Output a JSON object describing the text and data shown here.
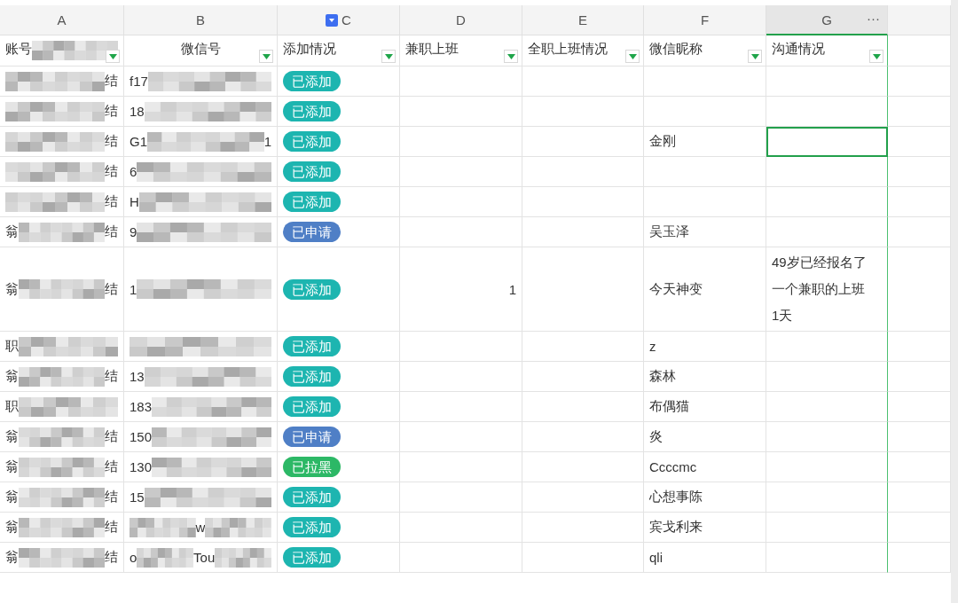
{
  "columns": [
    {
      "letter": "A",
      "selected": false,
      "filtered": false,
      "header": [
        {
          "kind": "text",
          "text": "账号"
        },
        {
          "kind": "mosaic"
        }
      ]
    },
    {
      "letter": "B",
      "selected": false,
      "filtered": false,
      "header": [
        {
          "kind": "text",
          "text": "微信号"
        }
      ]
    },
    {
      "letter": "C",
      "selected": false,
      "filtered": true,
      "header": [
        {
          "kind": "text",
          "text": "添加情况"
        }
      ]
    },
    {
      "letter": "D",
      "selected": false,
      "filtered": false,
      "header": [
        {
          "kind": "text",
          "text": "兼职上班"
        }
      ]
    },
    {
      "letter": "E",
      "selected": false,
      "filtered": false,
      "header": [
        {
          "kind": "text",
          "text": "全职上班情况"
        }
      ]
    },
    {
      "letter": "F",
      "selected": false,
      "filtered": false,
      "header": [
        {
          "kind": "text",
          "text": "微信昵称"
        }
      ]
    },
    {
      "letter": "G",
      "selected": true,
      "filtered": false,
      "more": "···",
      "header": [
        {
          "kind": "text",
          "text": "沟通情况"
        }
      ]
    }
  ],
  "rows": [
    {
      "account": [
        {
          "kind": "mosaic"
        },
        {
          "kind": "text",
          "text": "结"
        }
      ],
      "wechat_id": [
        {
          "kind": "text",
          "text": "f17"
        },
        {
          "kind": "mosaic"
        }
      ],
      "status": {
        "text": "已添加",
        "color": "#1db5b0"
      },
      "notes": {
        "selected": false
      }
    },
    {
      "account": [
        {
          "kind": "mosaic"
        },
        {
          "kind": "text",
          "text": "结"
        }
      ],
      "wechat_id": [
        {
          "kind": "text",
          "text": "18"
        },
        {
          "kind": "mosaic"
        }
      ],
      "status": {
        "text": "已添加",
        "color": "#1db5b0"
      },
      "notes": {
        "selected": false
      }
    },
    {
      "account": [
        {
          "kind": "mosaic"
        },
        {
          "kind": "text",
          "text": "结"
        }
      ],
      "wechat_id": [
        {
          "kind": "text",
          "text": "G1"
        },
        {
          "kind": "mosaic"
        },
        {
          "kind": "text",
          "text": "1"
        }
      ],
      "status": {
        "text": "已添加",
        "color": "#1db5b0"
      },
      "nickname": "金刚",
      "notes": {
        "selected": true
      }
    },
    {
      "account": [
        {
          "kind": "mosaic"
        },
        {
          "kind": "text",
          "text": "结"
        }
      ],
      "wechat_id": [
        {
          "kind": "text",
          "text": "6"
        },
        {
          "kind": "mosaic"
        }
      ],
      "status": {
        "text": "已添加",
        "color": "#1db5b0"
      },
      "notes": {
        "selected": false
      }
    },
    {
      "account": [
        {
          "kind": "mosaic"
        },
        {
          "kind": "text",
          "text": "结"
        }
      ],
      "wechat_id": [
        {
          "kind": "text",
          "text": "H"
        },
        {
          "kind": "mosaic"
        }
      ],
      "status": {
        "text": "已添加",
        "color": "#1db5b0"
      },
      "notes": {
        "selected": false
      }
    },
    {
      "account": [
        {
          "kind": "text",
          "text": "翁"
        },
        {
          "kind": "mosaic"
        },
        {
          "kind": "text",
          "text": "结"
        }
      ],
      "wechat_id": [
        {
          "kind": "text",
          "text": "9"
        },
        {
          "kind": "mosaic"
        }
      ],
      "status": {
        "text": "已申请",
        "color": "#4f7fc6"
      },
      "nickname": "吴玉泽",
      "notes": {
        "selected": false
      }
    },
    {
      "account": [
        {
          "kind": "text",
          "text": "翁"
        },
        {
          "kind": "mosaic"
        },
        {
          "kind": "text",
          "text": "结"
        }
      ],
      "wechat_id": [
        {
          "kind": "text",
          "text": "1"
        },
        {
          "kind": "mosaic"
        }
      ],
      "status": {
        "text": "已添加",
        "color": "#1db5b0"
      },
      "parttime": "1",
      "nickname": "今天神变",
      "notes": {
        "selected": false,
        "text": "49岁已经报名了一个兼职的上班1天"
      }
    },
    {
      "account": [
        {
          "kind": "text",
          "text": "职"
        },
        {
          "kind": "mosaic"
        }
      ],
      "wechat_id": [
        {
          "kind": "mosaic"
        }
      ],
      "status": {
        "text": "已添加",
        "color": "#1db5b0"
      },
      "nickname": "z",
      "notes": {
        "selected": false
      }
    },
    {
      "account": [
        {
          "kind": "text",
          "text": "翁"
        },
        {
          "kind": "mosaic"
        },
        {
          "kind": "text",
          "text": "结"
        }
      ],
      "wechat_id": [
        {
          "kind": "text",
          "text": "13"
        },
        {
          "kind": "mosaic"
        }
      ],
      "status": {
        "text": "已添加",
        "color": "#1db5b0"
      },
      "nickname": "森林",
      "notes": {
        "selected": false
      }
    },
    {
      "account": [
        {
          "kind": "text",
          "text": "职"
        },
        {
          "kind": "mosaic"
        }
      ],
      "wechat_id": [
        {
          "kind": "text",
          "text": "183"
        },
        {
          "kind": "mosaic"
        }
      ],
      "status": {
        "text": "已添加",
        "color": "#1db5b0"
      },
      "nickname": "布偶猫",
      "notes": {
        "selected": false
      }
    },
    {
      "account": [
        {
          "kind": "text",
          "text": "翁"
        },
        {
          "kind": "mosaic"
        },
        {
          "kind": "text",
          "text": "结"
        }
      ],
      "wechat_id": [
        {
          "kind": "text",
          "text": "150"
        },
        {
          "kind": "mosaic"
        }
      ],
      "status": {
        "text": "已申请",
        "color": "#4f7fc6"
      },
      "nickname": "炎",
      "notes": {
        "selected": false
      }
    },
    {
      "account": [
        {
          "kind": "text",
          "text": "翁"
        },
        {
          "kind": "mosaic"
        },
        {
          "kind": "text",
          "text": "结"
        }
      ],
      "wechat_id": [
        {
          "kind": "text",
          "text": "130"
        },
        {
          "kind": "mosaic"
        }
      ],
      "status": {
        "text": "已拉黑",
        "color": "#2cb866"
      },
      "nickname": "Ccccmc",
      "notes": {
        "selected": false
      }
    },
    {
      "account": [
        {
          "kind": "text",
          "text": "翁"
        },
        {
          "kind": "mosaic"
        },
        {
          "kind": "text",
          "text": "结"
        }
      ],
      "wechat_id": [
        {
          "kind": "text",
          "text": "15"
        },
        {
          "kind": "mosaic"
        }
      ],
      "status": {
        "text": "已添加",
        "color": "#1db5b0"
      },
      "nickname": "心想事陈",
      "notes": {
        "selected": false
      }
    },
    {
      "account": [
        {
          "kind": "text",
          "text": "翁"
        },
        {
          "kind": "mosaic"
        },
        {
          "kind": "text",
          "text": "结"
        }
      ],
      "wechat_id": [
        {
          "kind": "mosaic"
        },
        {
          "kind": "text",
          "text": "w"
        },
        {
          "kind": "mosaic"
        }
      ],
      "status": {
        "text": "已添加",
        "color": "#1db5b0"
      },
      "nickname": "宾戈利来",
      "notes": {
        "selected": false
      }
    },
    {
      "account": [
        {
          "kind": "text",
          "text": "翁"
        },
        {
          "kind": "mosaic"
        },
        {
          "kind": "text",
          "text": "结"
        }
      ],
      "wechat_id": [
        {
          "kind": "text",
          "text": "o"
        },
        {
          "kind": "mosaic"
        },
        {
          "kind": "text",
          "text": "Tou"
        },
        {
          "kind": "mosaic"
        }
      ],
      "status": {
        "text": "已添加",
        "color": "#1db5b0"
      },
      "nickname": "qli",
      "notes": {
        "selected": false
      }
    }
  ]
}
